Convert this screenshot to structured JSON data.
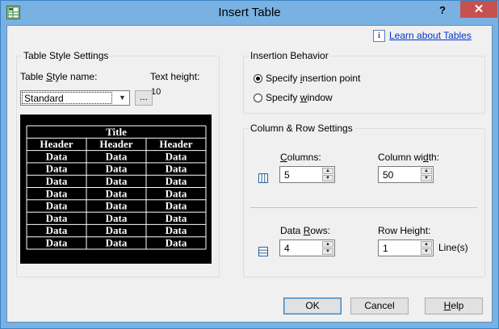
{
  "window": {
    "title": "Insert Table",
    "help_glyph": "?",
    "close_glyph": "✕",
    "app_icon": "table-app-icon"
  },
  "header": {
    "info_glyph": "i",
    "learn_link": "Learn about Tables"
  },
  "table_style": {
    "group_title": "Table Style Settings",
    "style_name_label_pre": "Table ",
    "style_name_label_key": "S",
    "style_name_label_post": "tyle name:",
    "style_value": "Standard",
    "text_height_label": "Text height:",
    "text_height_value": "10",
    "browse_label": "...",
    "preview": {
      "title": "Title",
      "headers": [
        "Header",
        "Header",
        "Header"
      ],
      "rows": [
        [
          "Data",
          "Data",
          "Data"
        ],
        [
          "Data",
          "Data",
          "Data"
        ],
        [
          "Data",
          "Data",
          "Data"
        ],
        [
          "Data",
          "Data",
          "Data"
        ],
        [
          "Data",
          "Data",
          "Data"
        ],
        [
          "Data",
          "Data",
          "Data"
        ],
        [
          "Data",
          "Data",
          "Data"
        ],
        [
          "Data",
          "Data",
          "Data"
        ]
      ]
    }
  },
  "insertion": {
    "group_title": "Insertion Behavior",
    "point_pre": "Specify ",
    "point_key": "i",
    "point_post": "nsertion point",
    "window_pre": "Specify ",
    "window_key": "w",
    "window_post": "indow",
    "selected": "point"
  },
  "col_row": {
    "group_title": "Column & Row Settings",
    "columns_label_key": "C",
    "columns_label_post": "olumns:",
    "columns_value": "5",
    "col_width_pre": "Column wi",
    "col_width_key": "d",
    "col_width_post": "th:",
    "col_width_value": "50",
    "data_rows_pre": "Data ",
    "data_rows_key": "R",
    "data_rows_post": "ows:",
    "data_rows_value": "4",
    "row_height_label": "Row Height:",
    "row_height_value": "1",
    "row_height_unit": "Line(s)"
  },
  "buttons": {
    "ok": "OK",
    "cancel": "Cancel",
    "help_key": "H",
    "help_post": "elp"
  }
}
